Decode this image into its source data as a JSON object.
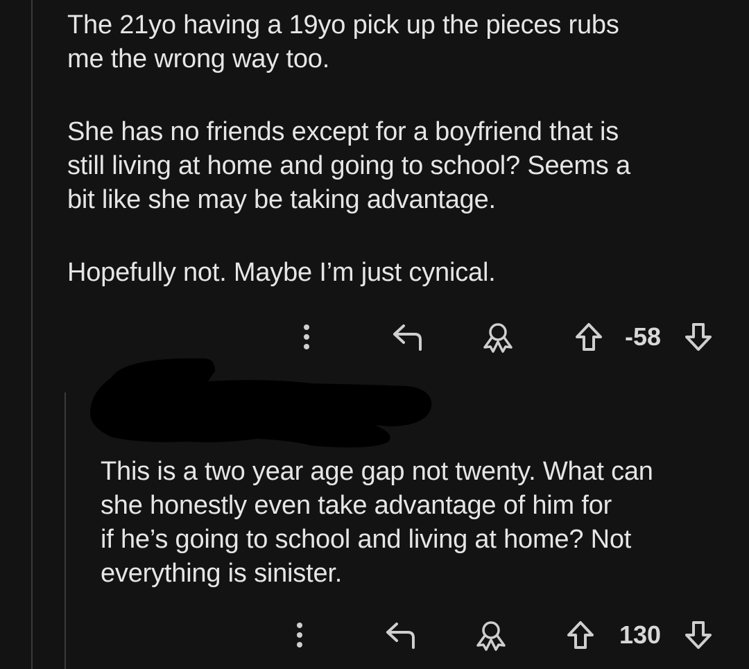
{
  "comment_1": {
    "paragraphs": [
      "The 21yo having a 19yo pick up the pieces rubs\nme the wrong way too.",
      "She has no friends except for a boyfriend that is\nstill living at home and going to school? Seems a\nbit like she may be taking advantage.",
      "Hopefully not. Maybe I’m just cynical."
    ],
    "score": "-58"
  },
  "comment_2": {
    "paragraphs": [
      "This is a two year age gap not twenty. What can\nshe honestly even take advantage of him for\nif he’s going to school and living at home? Not\neverything is sinister."
    ],
    "score": "130"
  },
  "icons": {
    "more": "more-vertical-icon",
    "reply": "reply-icon",
    "award": "award-icon",
    "upvote": "upvote-arrow-icon",
    "downvote": "downvote-arrow-icon"
  },
  "colors": {
    "background": "#131313",
    "text": "#e6e6e6",
    "icon": "#cfcfcf",
    "thread_line": "#3a3a3a",
    "redaction": "#000000"
  }
}
